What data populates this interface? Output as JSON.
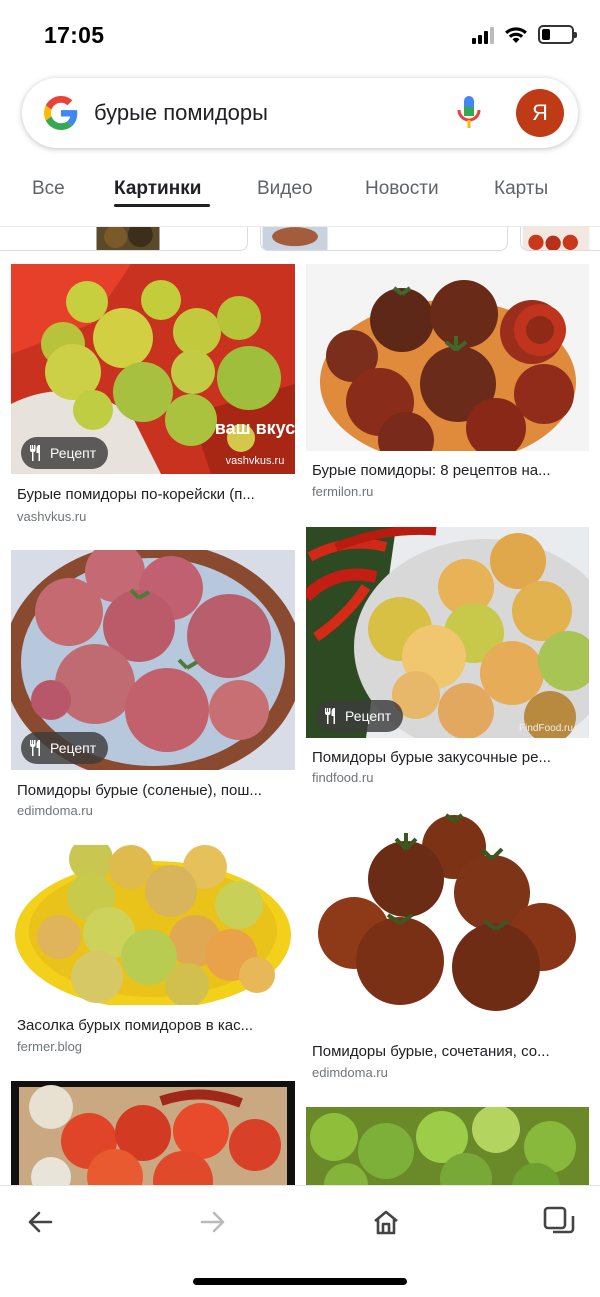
{
  "status_bar": {
    "time": "17:05"
  },
  "search": {
    "query": "бурые помидоры",
    "avatar_letter": "Я"
  },
  "tabs": [
    {
      "label": "Все"
    },
    {
      "label": "Картинки"
    },
    {
      "label": "Видео"
    },
    {
      "label": "Новости"
    },
    {
      "label": "Карты"
    }
  ],
  "active_tab": "Картинки",
  "badge_label": "Рецепт",
  "results": [
    {
      "title": "Бурые помидоры по-корейски (п...",
      "source": "vashvkus.ru",
      "recipe": true,
      "watermark": "ваш вкус",
      "watermark_sub": "vashvkus.ru"
    },
    {
      "title": "Бурые помидоры: 8 рецептов на...",
      "source": "fermilon.ru",
      "recipe": false
    },
    {
      "title": "Помидоры бурые (соленые), пош...",
      "source": "edimdoma.ru",
      "recipe": true
    },
    {
      "title": "Помидоры бурые закусочные ре...",
      "source": "findfood.ru",
      "recipe": true,
      "watermark": "FindFood.ru"
    },
    {
      "title": "Засолка бурых помидоров в кас...",
      "source": "fermer.blog",
      "recipe": false
    },
    {
      "title": "Помидоры бурые, сочетания, со...",
      "source": "edimdoma.ru",
      "recipe": false
    }
  ],
  "colors": {
    "avatar": "#bf3b16",
    "google_blue": "#4285F4",
    "google_red": "#EA4335",
    "google_yellow": "#FBBC05",
    "google_green": "#34A853"
  },
  "icons": [
    "google-logo-icon",
    "mic-icon",
    "back-arrow-icon",
    "forward-arrow-icon",
    "home-icon",
    "tabs-icon",
    "recipe-utensils-icon"
  ]
}
